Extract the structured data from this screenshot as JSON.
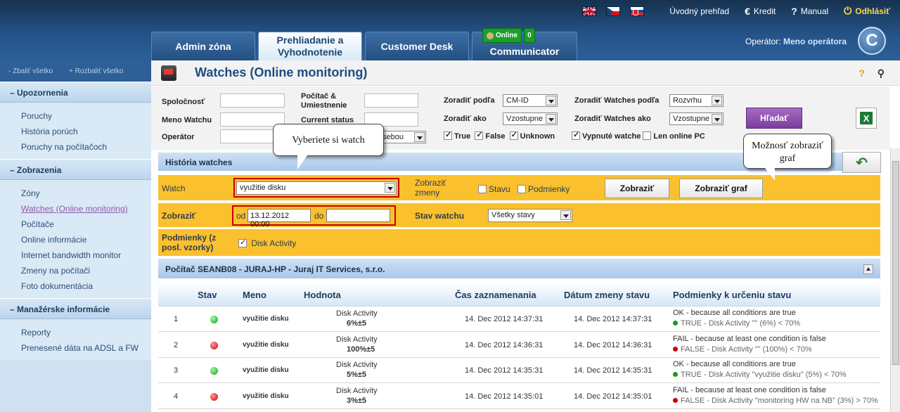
{
  "header": {
    "flags": [
      "uk-flag-icon",
      "cz-flag-icon",
      "sk-flag-icon"
    ],
    "links": [
      {
        "label": "Úvodný prehľad",
        "icon": ""
      },
      {
        "label": "Kredit",
        "icon": "€"
      },
      {
        "label": "Manual",
        "icon": "?"
      },
      {
        "label": "Odhlásiť",
        "icon": "⏻"
      }
    ],
    "tabs": [
      "Admin zóna",
      "Prehliadanie a Vyhodnotenie",
      "Customer Desk",
      "Communicator"
    ],
    "online_label": "Online",
    "online_count": "0",
    "operator_label": "Operátor:",
    "operator_name": "Meno operátora",
    "logo": "C"
  },
  "sidebar": {
    "collapse_all": "- Zbaliť všetko",
    "expand_all": "+ Rozbaliť všetko",
    "sections": [
      {
        "title": "Upozornenia",
        "items": [
          "Poruchy",
          "História porúch",
          "Poruchy na počítačoch"
        ]
      },
      {
        "title": "Zobrazenia",
        "items": [
          "Zóny",
          "Watches (Online monitoring)",
          "Počítače",
          "Online informácie",
          "Internet bandwidth monitor",
          "Zmeny na počítači",
          "Foto dokumentácia"
        ]
      },
      {
        "title": "Manažérske informácie",
        "items": [
          "Reporty",
          "Prenesené dáta na ADSL a FW"
        ]
      }
    ]
  },
  "page": {
    "title": "Watches (Online monitoring)",
    "help": "?",
    "search_icon": "🔍"
  },
  "filters": {
    "company": "Spoločnosť",
    "computer": "Počítač &",
    "computer2": "Umiestnenie",
    "watch_name": "Meno Watchu",
    "current_status": "Current status",
    "operator": "Operátor",
    "sort_by": "Zoradiť podľa",
    "sort_by_value": "CM-ID",
    "sort_how": "Zoradiť ako",
    "sort_how_value": "Vzostupne",
    "sort_watches_by": "Zoradiť Watches podľa",
    "sort_watches_by_value": "Rozvrhu",
    "sort_watches_how": "Zoradiť Watches ako",
    "sort_watches_how_value": "Vzostupne",
    "hidden_select_value": "sebou",
    "cb_true": "True",
    "cb_false": "False",
    "cb_unknown": "Unknown",
    "cb_disabled": "Vypnuté watche",
    "cb_online": "Len online PC",
    "search_button": "Hľadať"
  },
  "callouts": {
    "watch": "Vyberiete si watch",
    "graph": "Možnosť zobraziť graf"
  },
  "history": {
    "title": "História watches",
    "watch_label": "Watch",
    "watch_value": "využitie disku",
    "show_changes_label": "Zobraziť zmeny",
    "cb_status": "Stavu",
    "cb_conditions": "Podmienky",
    "show_button": "Zobraziť",
    "show_graph_button": "Zobraziť graf",
    "display_label": "Zobraziť",
    "from_label": "od",
    "from_value": "13.12.2012 00:00",
    "to_label": "do",
    "to_value": "",
    "status_label": "Stav watchu",
    "status_value": "Všetky stavy",
    "conditions_label": "Podmienky (z posl. vzorky)",
    "cond_disk": "Disk Activity"
  },
  "computer": {
    "title": "Počítač SEANB08 - JURAJ-HP - Juraj IT Services, s.r.o."
  },
  "table": {
    "headers": [
      "Stav",
      "Meno",
      "Hodnota",
      "Čas zaznamenania",
      "Dátum zmeny stavu",
      "Podmienky k určeniu stavu"
    ],
    "rows": [
      {
        "n": "1",
        "status": "green",
        "name": "využitie disku",
        "value_label": "Disk Activity",
        "value": "6%±5",
        "time": "14. Dec 2012 14:37:31",
        "change": "14. Dec 2012 14:37:31",
        "cond1": "OK - because all conditions are true",
        "cond2": "TRUE - Disk Activity \"\" (6%) < 70%"
      },
      {
        "n": "2",
        "status": "red",
        "name": "využitie disku",
        "value_label": "Disk Activity",
        "value": "100%±5",
        "time": "14. Dec 2012 14:36:31",
        "change": "14. Dec 2012 14:36:31",
        "cond1": "FAIL - because at least one condition is false",
        "cond2": "FALSE - Disk Activity \"\" (100%) < 70%"
      },
      {
        "n": "3",
        "status": "green",
        "name": "využitie disku",
        "value_label": "Disk Activity",
        "value": "5%±5",
        "time": "14. Dec 2012 14:35:31",
        "change": "14. Dec 2012 14:35:31",
        "cond1": "OK - because all conditions are true",
        "cond2": "TRUE - Disk Activity \"využitie disku\" (5%) < 70%"
      },
      {
        "n": "4",
        "status": "red",
        "name": "využitie disku",
        "value_label": "Disk Activity",
        "value": "3%±5",
        "time": "14. Dec 2012 14:35:01",
        "change": "14. Dec 2012 14:35:01",
        "cond1": "FAIL - because at least one condition is false",
        "cond2": "FALSE - Disk Activity \"monitoring HW na NB\" (3%) > 70%"
      }
    ]
  }
}
